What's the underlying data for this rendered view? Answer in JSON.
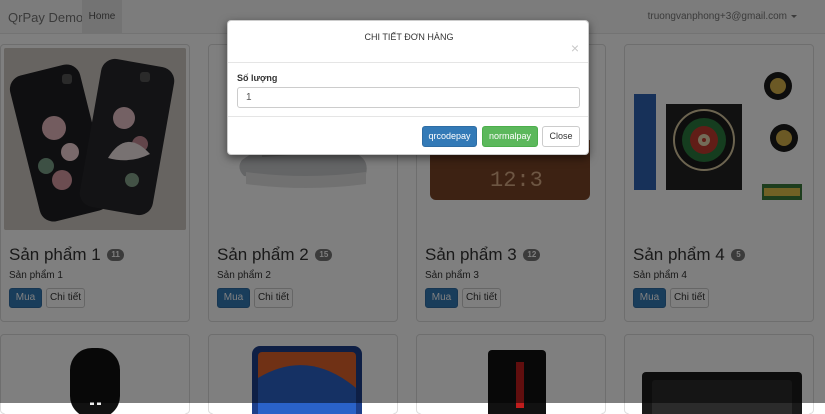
{
  "navbar": {
    "brand": "QrPay Demo",
    "home": "Home",
    "user": "truongvanphong+3@gmail.com"
  },
  "products": [
    {
      "title": "Sản phẩm 1",
      "badge": "11",
      "desc": "Sản phẩm 1",
      "buy": "Mua",
      "detail": "Chi tiết"
    },
    {
      "title": "Sản phẩm 2",
      "badge": "15",
      "desc": "Sản phẩm 2",
      "buy": "Mua",
      "detail": "Chi tiết"
    },
    {
      "title": "Sản phẩm 3",
      "badge": "12",
      "desc": "Sản phẩm 3",
      "buy": "Mua",
      "detail": "Chi tiết"
    },
    {
      "title": "Sản phẩm 4",
      "badge": "5",
      "desc": "Sản phẩm 4",
      "buy": "Mua",
      "detail": "Chi tiết"
    }
  ],
  "modal": {
    "title": "CHI TIẾT ĐƠN HÀNG",
    "close_glyph": "×",
    "qty_label": "Số lượng",
    "qty_value": "1",
    "qrcode_label": "qrcodepay",
    "normal_label": "normalpay",
    "close_label": "Close"
  },
  "colors": {
    "primary": "#337ab7",
    "success": "#5cb85c",
    "badge": "#777777"
  }
}
